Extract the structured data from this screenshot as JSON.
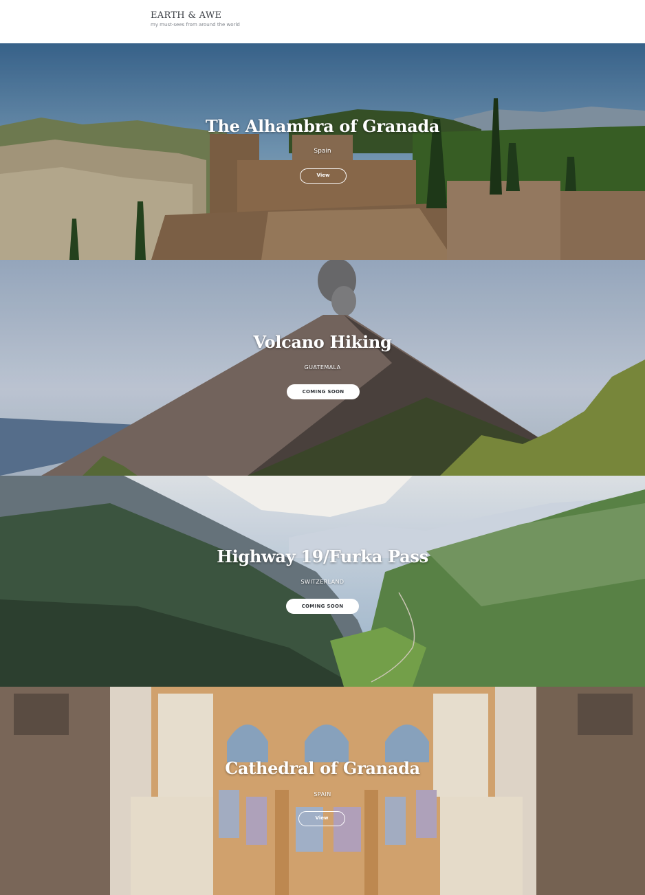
{
  "header": {
    "title": "EARTH & AWE",
    "tagline": "my must-sees from around the world"
  },
  "sections": [
    {
      "title": "The Alhambra of Granada",
      "subtitle": "Spain",
      "button": "View"
    },
    {
      "title": "Volcano Hiking",
      "subtitle": "GUATEMALA",
      "button": "COMING SOON"
    },
    {
      "title": "Highway 19/Furka Pass",
      "subtitle": "SWITZERLAND",
      "button": "COMING SOON"
    },
    {
      "title": "Cathedral of Granada",
      "subtitle": "SPAIN",
      "button": "View"
    }
  ],
  "colors": {
    "header_text": "#3b3f45",
    "tagline_text": "#7c8088",
    "overlay_text": "#ffffff"
  }
}
